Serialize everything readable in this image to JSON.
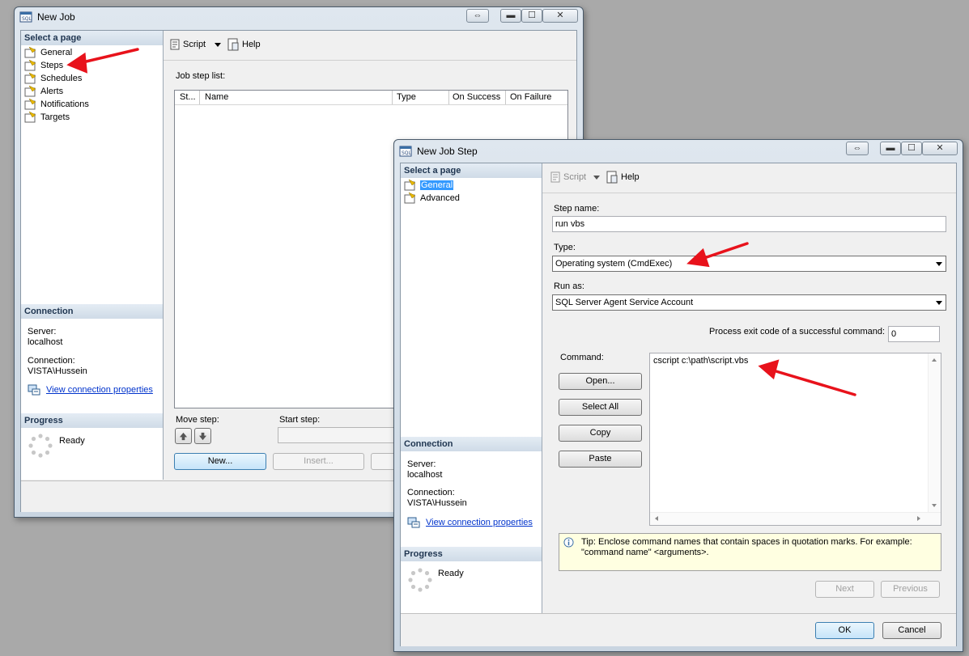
{
  "job_window": {
    "title": "New Job",
    "select_page_header": "Select a page",
    "pages": [
      "General",
      "Steps",
      "Schedules",
      "Alerts",
      "Notifications",
      "Targets"
    ],
    "toolbar": {
      "script": "Script",
      "help": "Help"
    },
    "job_step_list_label": "Job step list:",
    "columns": [
      "St...",
      "Name",
      "Type",
      "On Success",
      "On Failure"
    ],
    "move_step_label": "Move step:",
    "start_step_label": "Start step:",
    "buttons": {
      "new": "New...",
      "insert": "Insert..."
    },
    "connection": {
      "header": "Connection",
      "server_label": "Server:",
      "server_value": "localhost",
      "connection_label": "Connection:",
      "connection_value": "VISTA\\Hussein",
      "view_link": "View connection properties"
    },
    "progress": {
      "header": "Progress",
      "status": "Ready"
    }
  },
  "step_window": {
    "title": "New Job Step",
    "select_page_header": "Select a page",
    "pages": [
      "General",
      "Advanced"
    ],
    "selected_page": "General",
    "toolbar": {
      "script": "Script",
      "help": "Help"
    },
    "step_name_label": "Step name:",
    "step_name_value": "run vbs",
    "type_label": "Type:",
    "type_value": "Operating system (CmdExec)",
    "run_as_label": "Run as:",
    "run_as_value": "SQL Server Agent Service Account",
    "exit_code_label": "Process exit code of a successful command:",
    "exit_code_value": "0",
    "command_label": "Command:",
    "command_value": "cscript c:\\path\\script.vbs",
    "command_buttons": {
      "open": "Open...",
      "select_all": "Select All",
      "copy": "Copy",
      "paste": "Paste"
    },
    "tip_line1": "Tip: Enclose command names that contain spaces in quotation marks. For example:",
    "tip_line2": "\"command name\" <arguments>.",
    "nav_buttons": {
      "next": "Next",
      "previous": "Previous"
    },
    "dialog_buttons": {
      "ok": "OK",
      "cancel": "Cancel"
    },
    "connection": {
      "header": "Connection",
      "server_label": "Server:",
      "server_value": "localhost",
      "connection_label": "Connection:",
      "connection_value": "VISTA\\Hussein",
      "view_link": "View connection properties"
    },
    "progress": {
      "header": "Progress",
      "status": "Ready"
    }
  },
  "annotation_color": "#e8121b"
}
